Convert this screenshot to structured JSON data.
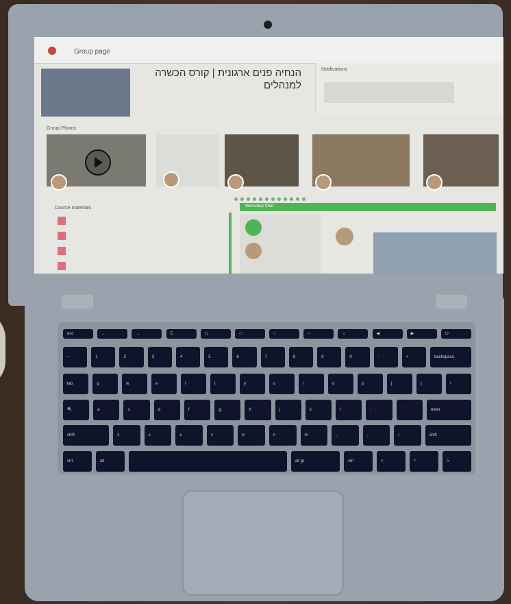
{
  "screen": {
    "group_label": "Group page",
    "hebrew_title": "הנחיה פנים ארגונית | קורס הכשרה למנהלים",
    "notifications": {
      "title": "Notifications"
    },
    "group_photos": {
      "title": "Group Photos"
    },
    "course_materials": {
      "title": "Course materials"
    },
    "workshop_chat": {
      "title": "Workshop Chat"
    }
  },
  "keyboard": {
    "rows": [
      [
        "esc",
        "←",
        "→",
        "C",
        "▢",
        "▭",
        "○",
        "○",
        "☼",
        "◀",
        "▶",
        "⏻"
      ],
      [
        "~",
        "1",
        "2",
        "3",
        "4",
        "5",
        "6",
        "7",
        "8",
        "9",
        "0",
        "-",
        "+",
        "backspace"
      ],
      [
        "tab",
        "q",
        "w",
        "e",
        "r",
        "t",
        "y",
        "u",
        "i",
        "o",
        "p",
        "[",
        "]",
        "\\"
      ],
      [
        "🔍",
        "a",
        "s",
        "d",
        "f",
        "g",
        "h",
        "j",
        "k",
        "l",
        ";",
        "'",
        "enter"
      ],
      [
        "shift",
        "z",
        "x",
        "c",
        "v",
        "b",
        "n",
        "m",
        ",",
        ".",
        "/",
        "shift"
      ],
      [
        "ctrl",
        "alt",
        "",
        "alt gr",
        "ctrl",
        "<",
        "^",
        ">"
      ]
    ]
  }
}
